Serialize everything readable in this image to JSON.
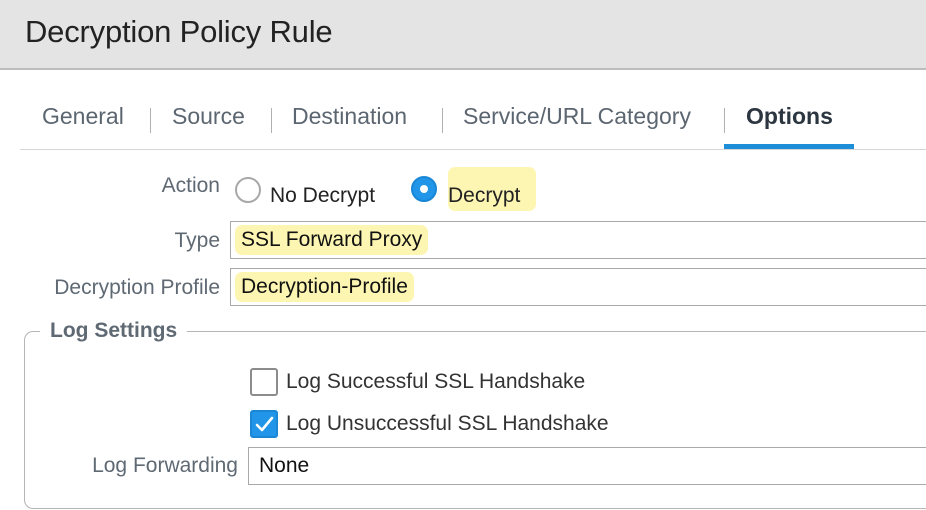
{
  "dialog": {
    "title": "Decryption Policy Rule"
  },
  "tabs": [
    {
      "label": "General"
    },
    {
      "label": "Source"
    },
    {
      "label": "Destination"
    },
    {
      "label": "Service/URL Category"
    },
    {
      "label": "Options",
      "active": true
    }
  ],
  "options": {
    "action": {
      "label": "Action",
      "choices": [
        {
          "label": "No Decrypt",
          "selected": false
        },
        {
          "label": "Decrypt",
          "selected": true
        }
      ]
    },
    "type": {
      "label": "Type",
      "value": "SSL Forward Proxy"
    },
    "decryption_profile": {
      "label": "Decryption Profile",
      "value": "Decryption-Profile"
    },
    "log_settings": {
      "legend": "Log Settings",
      "successful": {
        "label": "Log Successful SSL Handshake",
        "checked": false
      },
      "unsuccessful": {
        "label": "Log Unsuccessful SSL Handshake",
        "checked": true
      },
      "log_forwarding": {
        "label": "Log Forwarding",
        "value": "None"
      }
    }
  },
  "colors": {
    "accent": "#2196e8",
    "highlight": "#fdf6b3",
    "header_bg": "#e4e4e4",
    "label_text": "#5f6973"
  }
}
